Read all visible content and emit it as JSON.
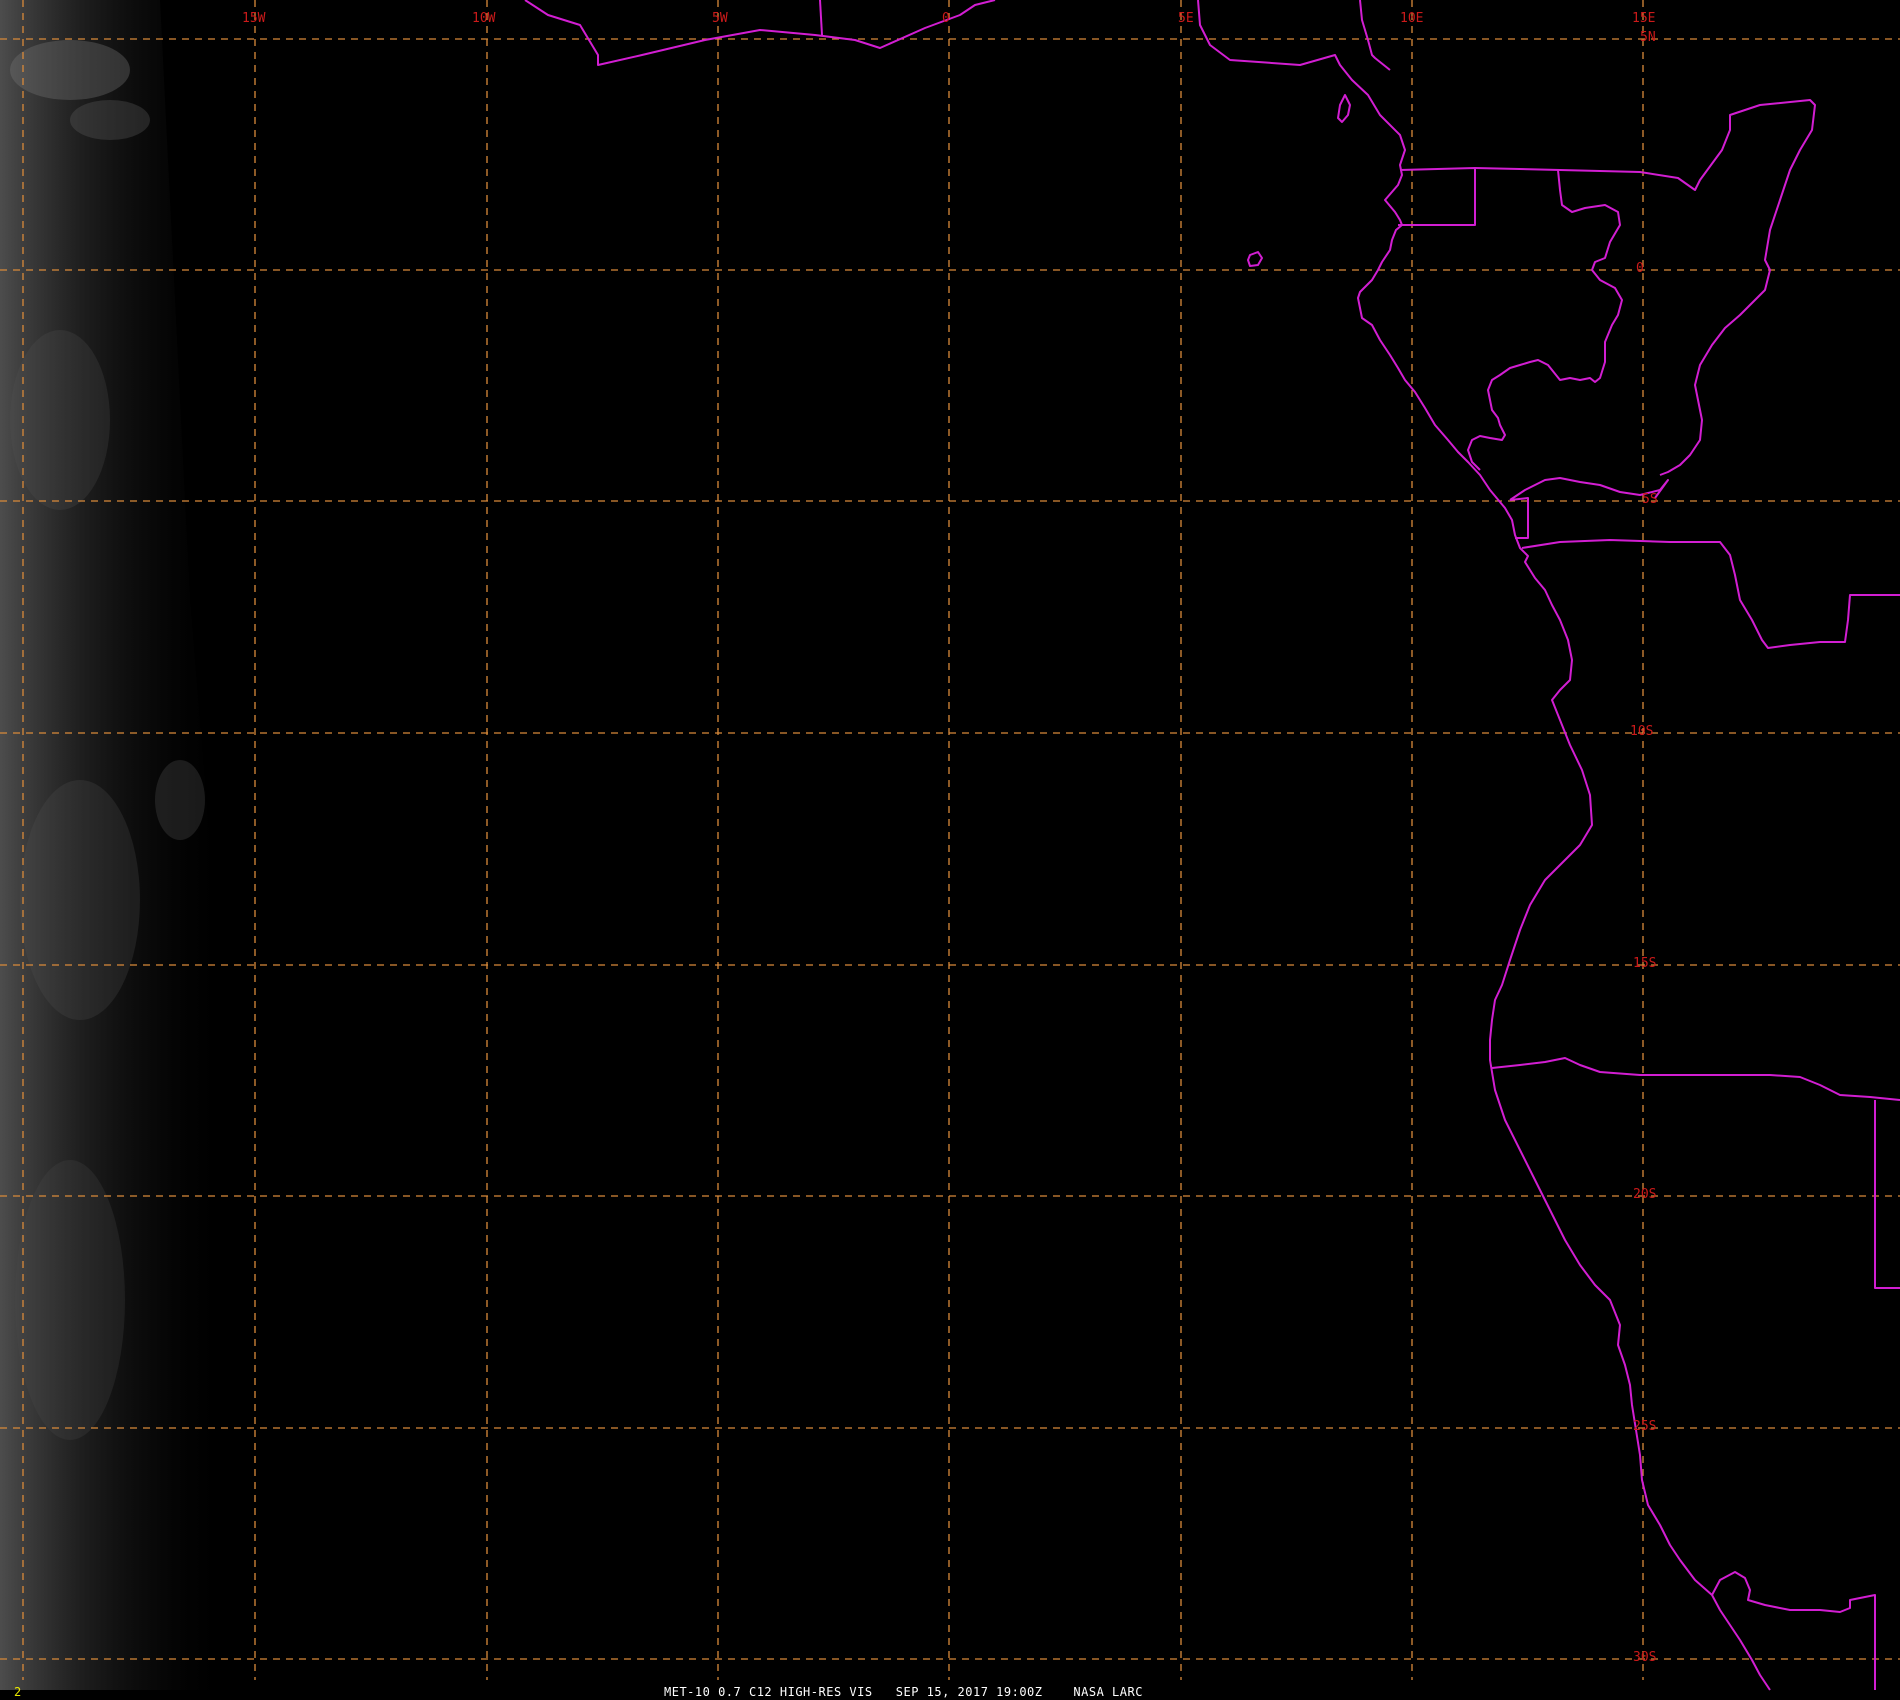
{
  "footer": {
    "frame_number": "2",
    "caption": "MET-10 0.7 C12 HIGH-RES VIS   SEP 15, 2017 19:00Z    NASA LARC"
  },
  "grid": {
    "lon_labels": [
      "15W",
      "10W",
      "5W",
      "0",
      "5E",
      "10E",
      "15E"
    ],
    "lat_labels": [
      "5N",
      "0",
      "5S",
      "10S",
      "15S",
      "20S",
      "25S",
      "30S"
    ]
  },
  "colors": {
    "background": "#000000",
    "gridlines": "#d98a3a",
    "grid_labels": "#cc1a1a",
    "boundaries": "#d21ed2",
    "caption": "#ffffff",
    "frame_number": "#e8e800"
  }
}
